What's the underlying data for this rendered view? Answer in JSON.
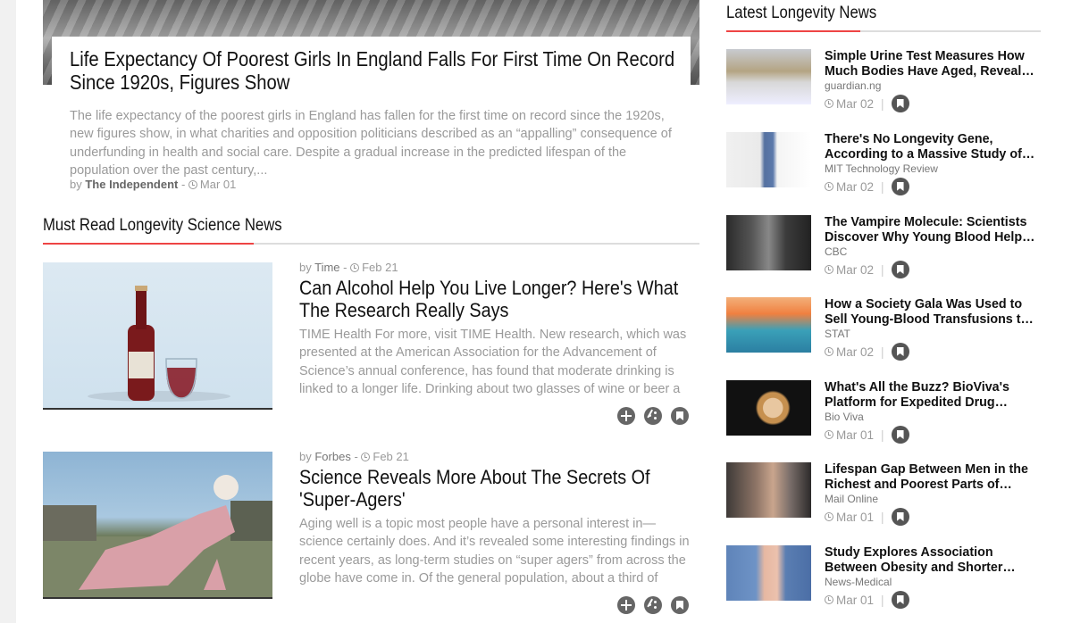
{
  "hero": {
    "title": "Life Expectancy Of Poorest Girls In England Falls For First Time On Record Since 1920s, Figures Show",
    "excerpt": "The life expectancy of the poorest girls in England has fallen for the first time on record since the 1920s, new figures show, in what charities and opposition politicians described as an “appalling” consequence of underfunding in health and social care. Despite a gradual increase in the predicted lifespan of the population over the past century,...",
    "by_prefix": "by",
    "source": "The Independent",
    "date": "Mar 01"
  },
  "must_read": {
    "heading": "Must Read Longevity Science News",
    "articles": [
      {
        "by_prefix": "by",
        "source": "Time",
        "date": "Feb 21",
        "title": "Can Alcohol Help You Live Longer? Here's What The Research Really Says",
        "excerpt": "TIME Health For more, visit TIME Health. New research, which was presented at the American Association for the Advancement of Science’s annual conference, has found that moderate drinking is linked to a longer life. Drinking about two glasses of wine or beer a day was li..."
      },
      {
        "by_prefix": "by",
        "source": "Forbes",
        "date": "Feb 21",
        "title": "Science Reveals More About The Secrets Of 'Super-Agers'",
        "excerpt": "Aging well is a topic most people have a personal interest in—science certainly does. And it’s revealed some interesting findings in recent years, as long-term studies on “super agers” from across the globe have come in. Of the general population, about a third of people above the a..."
      }
    ]
  },
  "latest": {
    "heading": "Latest Longevity News",
    "items": [
      {
        "title": "Simple Urine Test Measures How Much Bodies Have Aged, Reveal Yea...",
        "source": "guardian.ng",
        "date": "Mar 02"
      },
      {
        "title": "There's No Longevity Gene, According to a Massive Study of Family Trees",
        "source": "MIT Technology Review",
        "date": "Mar 02"
      },
      {
        "title": "The Vampire Molecule: Scientists Discover Why Young Blood Helps Re...",
        "source": "CBC",
        "date": "Mar 02"
      },
      {
        "title": "How a Society Gala Was Used to Sell Young-Blood Transfusions to Baby B...",
        "source": "STAT",
        "date": "Mar 02"
      },
      {
        "title": "What's All the Buzz? BioViva's Platform for Expedited Drug Develop...",
        "source": "Bio Viva",
        "date": "Mar 01"
      },
      {
        "title": "Lifespan Gap Between Men in the Richest and Poorest Parts of Britain...",
        "source": "Mail Online",
        "date": "Mar 01"
      },
      {
        "title": "Study Explores Association Between Obesity and Shorter Longevity",
        "source": "News-Medical",
        "date": "Mar 01"
      }
    ]
  },
  "separator": "|",
  "colors": {
    "accent": "#e44444",
    "muted_text": "#9a9a9a"
  },
  "icons": [
    "clock-icon",
    "plus-icon",
    "share-icon",
    "bookmark-icon"
  ]
}
